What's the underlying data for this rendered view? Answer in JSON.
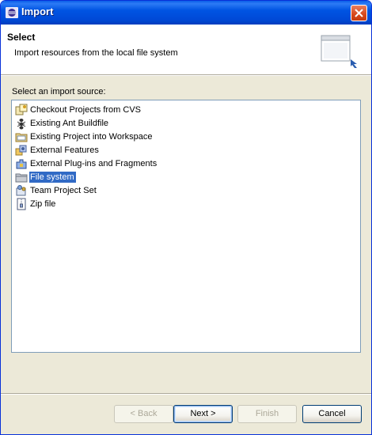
{
  "window": {
    "title": "Import",
    "close_icon": "close-icon"
  },
  "header": {
    "title": "Select",
    "message": "Import resources from the local file system",
    "banner_icon": "import-wizard-banner-icon"
  },
  "source": {
    "label": "Select an import source:",
    "items": [
      {
        "label": "Checkout Projects from CVS",
        "icon": "cvs-icon",
        "selected": false
      },
      {
        "label": "Existing Ant Buildfile",
        "icon": "ant-icon",
        "selected": false
      },
      {
        "label": "Existing Project into Workspace",
        "icon": "project-icon",
        "selected": false
      },
      {
        "label": "External Features",
        "icon": "feature-icon",
        "selected": false
      },
      {
        "label": "External Plug-ins and Fragments",
        "icon": "plugin-icon",
        "selected": false
      },
      {
        "label": "File system",
        "icon": "folder-icon",
        "selected": true
      },
      {
        "label": "Team Project Set",
        "icon": "team-icon",
        "selected": false
      },
      {
        "label": "Zip file",
        "icon": "zip-icon",
        "selected": false
      }
    ]
  },
  "buttons": {
    "back": "< Back",
    "next": "Next >",
    "finish": "Finish",
    "cancel": "Cancel"
  },
  "colors": {
    "titlebar": "#0054e3",
    "selection": "#316ac5",
    "dialog_bg": "#ece9d8"
  }
}
